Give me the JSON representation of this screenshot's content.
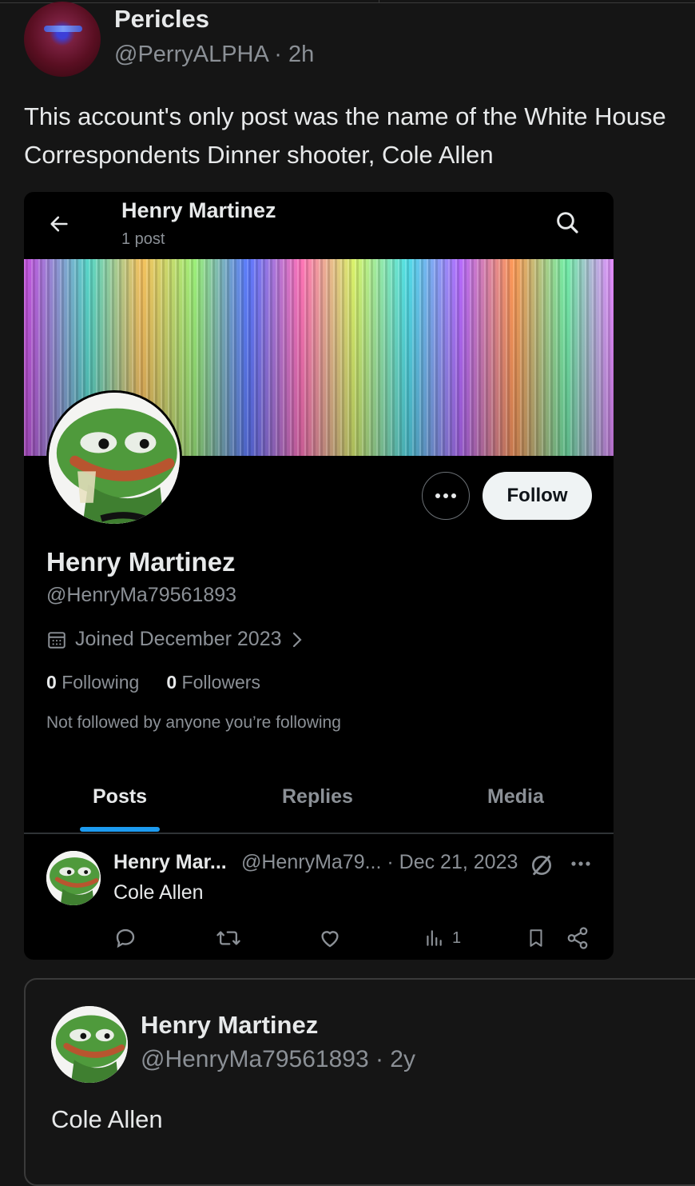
{
  "outer_post": {
    "author_name": "Pericles",
    "author_meta": "@PerryALPHA · 2h",
    "text": "This account's only post was the name of the White House Correspondents Dinner shooter, Cole Allen"
  },
  "profile_header": {
    "title": "Henry Martinez",
    "post_count": "1 post"
  },
  "profile": {
    "name": "Henry Martinez",
    "handle": "@HenryMa79561893",
    "joined": "Joined December 2023",
    "following_count": "0",
    "following_label": "Following",
    "followers_count": "0",
    "followers_label": "Followers",
    "mutual_note": "Not followed by anyone you’re following",
    "follow_label": "Follow"
  },
  "tabs": [
    {
      "label": "Posts",
      "active": true
    },
    {
      "label": "Replies",
      "active": false
    },
    {
      "label": "Media",
      "active": false
    }
  ],
  "post_row": {
    "name": "Henry Mar...",
    "meta": "@HenryMa79... · Dec 21, 2023",
    "text": "Cole Allen",
    "views": "1"
  },
  "quoted_post": {
    "name": "Henry Martinez",
    "meta": "@HenryMa79561893 · 2y",
    "text": "Cole Allen"
  },
  "colors": {
    "accent": "#1d9bf0",
    "background": "#151515",
    "card_bg": "#000000",
    "secondary_text": "#8b9096"
  },
  "icons": [
    "arrow-left-icon",
    "search-icon",
    "more-icon",
    "calendar-icon",
    "chevron-right-icon",
    "reply-icon",
    "retweet-icon",
    "heart-icon",
    "views-icon",
    "bookmark-icon",
    "share-icon",
    "no-edit-icon"
  ]
}
